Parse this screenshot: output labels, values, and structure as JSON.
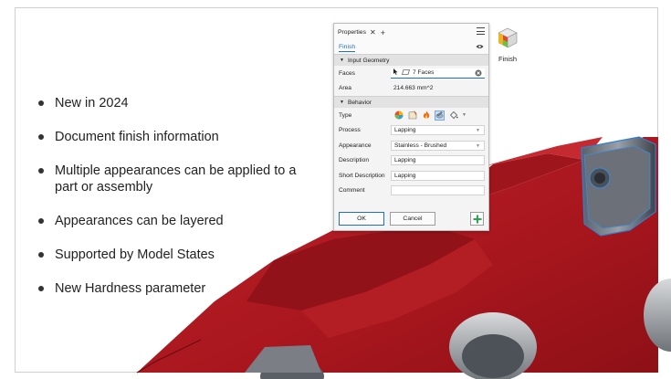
{
  "bullets": [
    "New in 2024",
    "Document finish information",
    "Multiple appearances can be applied to a part or assembly",
    "Appearances can be layered",
    "Supported by Model States",
    "New Hardness parameter"
  ],
  "properties_panel": {
    "title": "Properties",
    "tab": "Finish",
    "input_geometry": {
      "header": "Input Geometry",
      "faces_label": "Faces",
      "faces_value": "7 Faces",
      "area_label": "Area",
      "area_value": "214.663 mm^2"
    },
    "behavior": {
      "header": "Behavior",
      "type_label": "Type",
      "process_label": "Process",
      "process_value": "Lapping",
      "appearance_label": "Appearance",
      "appearance_value": "Stainless - Brushed",
      "description_label": "Description",
      "description_value": "Lapping",
      "short_description_label": "Short Description",
      "short_description_value": "Lapping",
      "comment_label": "Comment",
      "comment_value": ""
    },
    "ok_label": "OK",
    "cancel_label": "Cancel"
  },
  "finish_command": {
    "label": "Finish"
  },
  "colors": {
    "accent": "#1e6fc5",
    "part_red": "#b51d24",
    "add_green": "#2aa44f"
  }
}
